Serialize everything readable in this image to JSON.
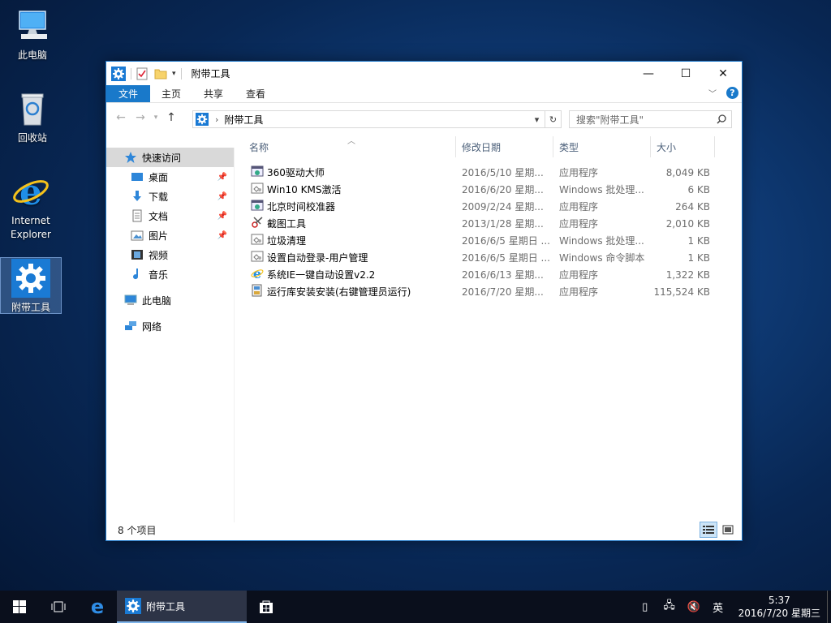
{
  "desktop": {
    "icons": [
      {
        "label": "此电脑"
      },
      {
        "label": "回收站"
      },
      {
        "label": "Internet Explorer",
        "line1": "Internet",
        "line2": "Explorer"
      },
      {
        "label": "附带工具"
      }
    ]
  },
  "window": {
    "title": "附带工具",
    "controls": {
      "minimize": "—",
      "maximize": "☐",
      "close": "✕"
    },
    "ribbon": {
      "tabs": [
        "文件",
        "主页",
        "共享",
        "查看"
      ],
      "help": "?"
    },
    "address": {
      "path": "附带工具",
      "chevron": "›"
    },
    "search": {
      "placeholder": "搜索\"附带工具\""
    },
    "nav_pane": [
      {
        "label": "快速访问",
        "pinned": false
      },
      {
        "label": "桌面",
        "pinned": true
      },
      {
        "label": "下载",
        "pinned": true
      },
      {
        "label": "文档",
        "pinned": true
      },
      {
        "label": "图片",
        "pinned": true
      },
      {
        "label": "视频",
        "pinned": false
      },
      {
        "label": "音乐",
        "pinned": false
      },
      {
        "label": "此电脑",
        "pinned": false
      },
      {
        "label": "网络",
        "pinned": false
      }
    ],
    "columns": [
      "名称",
      "修改日期",
      "类型",
      "大小"
    ],
    "files": [
      {
        "name": "360驱动大师",
        "date": "2016/5/10 星期...",
        "type": "应用程序",
        "size": "8,049 KB",
        "icon": "app-icon"
      },
      {
        "name": "Win10 KMS激活",
        "date": "2016/6/20 星期...",
        "type": "Windows 批处理...",
        "size": "6 KB",
        "icon": "batch-icon"
      },
      {
        "name": "北京时间校准器",
        "date": "2009/2/24 星期...",
        "type": "应用程序",
        "size": "264 KB",
        "icon": "app-icon"
      },
      {
        "name": "截图工具",
        "date": "2013/1/28 星期...",
        "type": "应用程序",
        "size": "2,010 KB",
        "icon": "screenshot-icon"
      },
      {
        "name": "垃圾清理",
        "date": "2016/6/5 星期日 ...",
        "type": "Windows 批处理...",
        "size": "1 KB",
        "icon": "batch-icon"
      },
      {
        "name": "设置自动登录-用户管理",
        "date": "2016/6/5 星期日 ...",
        "type": "Windows 命令脚本",
        "size": "1 KB",
        "icon": "batch-icon"
      },
      {
        "name": "系统IE一键自动设置v2.2",
        "date": "2016/6/13 星期...",
        "type": "应用程序",
        "size": "1,322 KB",
        "icon": "ie-icon"
      },
      {
        "name": "运行库安装安装(右键管理员运行)",
        "date": "2016/7/20 星期...",
        "type": "应用程序",
        "size": "115,524 KB",
        "icon": "installer-icon"
      }
    ],
    "status": "8 个项目"
  },
  "taskbar": {
    "active_app": "附带工具",
    "ime": "英",
    "time": "5:37",
    "date": "2016/7/20 星期三"
  }
}
